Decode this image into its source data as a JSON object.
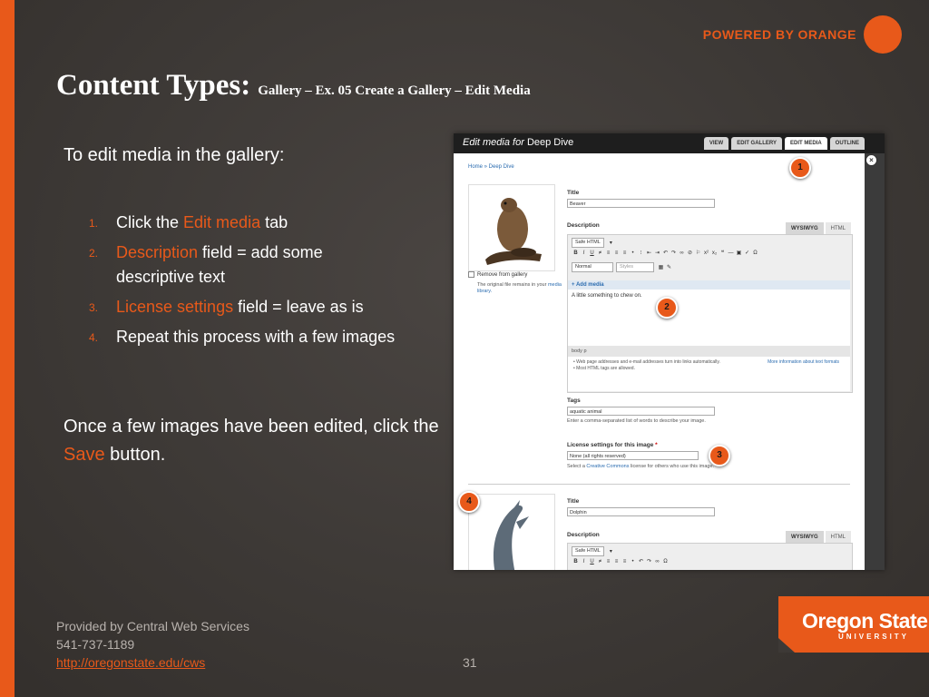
{
  "branding": {
    "powered_by": "POWERED BY ORANGE",
    "logo_name": "Oregon State",
    "logo_sub": "UNIVERSITY"
  },
  "title": {
    "main": "Content Types:",
    "sub": "Gallery – Ex. 05 Create a Gallery – Edit Media"
  },
  "intro": "To edit media in the gallery:",
  "steps": [
    {
      "num": "1.",
      "pre": "Click the ",
      "highlight": "Edit media",
      "post": " tab"
    },
    {
      "num": "2.",
      "pre": "",
      "highlight": "Description",
      "post": " field = add some descriptive text"
    },
    {
      "num": "3.",
      "pre": "",
      "highlight": "License settings",
      "post": " field = leave as is"
    },
    {
      "num": "4.",
      "pre": "Repeat this process with a few images",
      "highlight": "",
      "post": ""
    }
  ],
  "closing": {
    "pre": "Once a few images have been edited, click the ",
    "highlight": "Save",
    "post": " button."
  },
  "footer": {
    "line1": "Provided by Central Web Services",
    "line2": "541-737-1189",
    "link": "http://oregonstate.edu/cws"
  },
  "page_number": "31",
  "screenshot": {
    "header_italic": "Edit media for",
    "header_name": "Deep Dive",
    "tabs": [
      "VIEW",
      "EDIT GALLERY",
      "EDIT MEDIA",
      "OUTLINE"
    ],
    "active_tab": "EDIT MEDIA",
    "breadcrumb": "Home » Deep Dive",
    "close_glyph": "×",
    "remove_label": "Remove from gallery",
    "note_text": "The original file remains in your",
    "note_link": "media library.",
    "item1": {
      "title_label": "Title",
      "title_value": "Beaver",
      "description_label": "Description",
      "editor_tabs": [
        "WYSIWYG",
        "HTML"
      ],
      "format_select": "Safe HTML",
      "style_select": "Normal",
      "styles_placeholder": "Styles",
      "add_media": "+ Add media",
      "body_text": "A little something to chew on.",
      "path": "body  p",
      "hint1": "Web page addresses and e-mail addresses turn into links automatically.",
      "hint2": "Most HTML tags are allowed.",
      "hint_link": "More information about text formats",
      "tags_label": "Tags",
      "tags_value": "aquatic animal",
      "tags_help": "Enter a comma-separated list of words to describe your image.",
      "license_label": "License settings for this image",
      "required_mark": "*",
      "license_value": "None (all rights reserved)",
      "license_help_pre": "Select a ",
      "license_help_link": "Creative Commons",
      "license_help_post": " license for others who use this image."
    },
    "item2": {
      "title_label": "Title",
      "title_value": "Dolphin",
      "description_label": "Description",
      "editor_tabs": [
        "WYSIWYG",
        "HTML"
      ],
      "format_select": "Safe HTML"
    },
    "badges": [
      "1",
      "2",
      "3",
      "4"
    ]
  },
  "colors": {
    "accent": "#e8591a",
    "background": "#3d3936",
    "link": "#2b6cb0"
  }
}
